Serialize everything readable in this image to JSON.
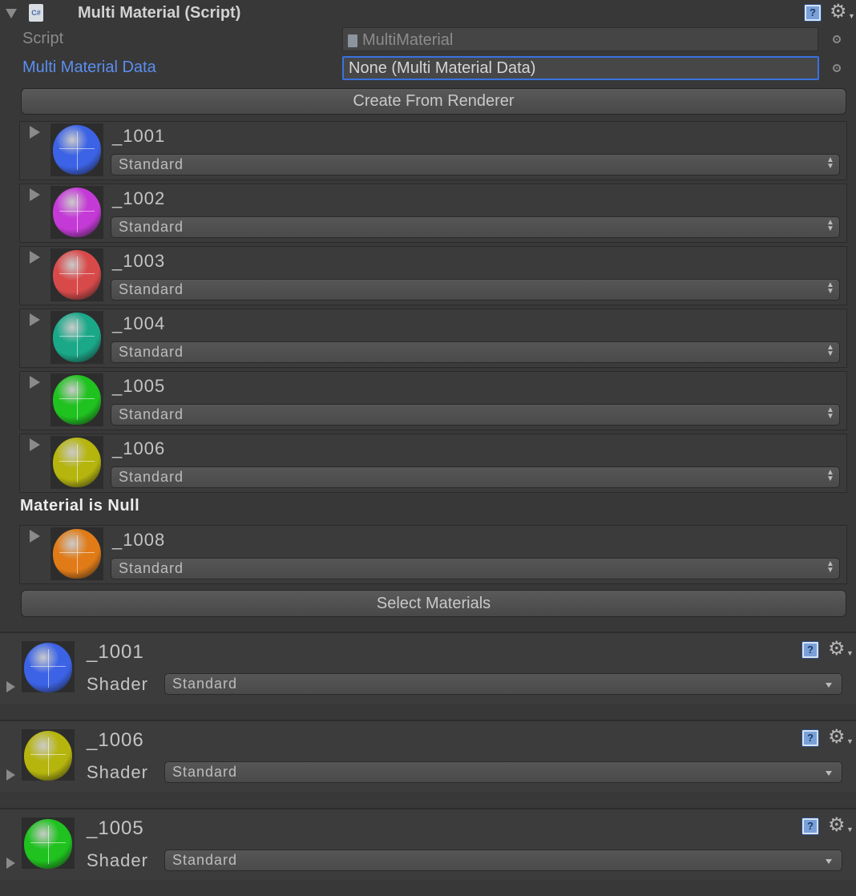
{
  "component": {
    "icon": "csharp-script-icon",
    "icon_text": "C#",
    "title": "Multi Material (Script)",
    "script_label": "Script",
    "script_value": "MultiMaterial",
    "data_label": "Multi Material Data",
    "data_value": "None (Multi Material Data)",
    "create_button": "Create From Renderer",
    "select_button": "Select Materials"
  },
  "colors": {
    "background": "#383838",
    "accent_label": "#5b8ef0",
    "focus_border": "#3a72e0"
  },
  "material_rows": [
    {
      "name": "_1001",
      "shader": "Standard",
      "color": "#3c63e6"
    },
    {
      "name": "_1002",
      "shader": "Standard",
      "color": "#c43ad6"
    },
    {
      "name": "_1003",
      "shader": "Standard",
      "color": "#d84a4a"
    },
    {
      "name": "_1004",
      "shader": "Standard",
      "color": "#1aa889"
    },
    {
      "name": "_1005",
      "shader": "Standard",
      "color": "#1fc21f"
    },
    {
      "name": "_1006",
      "shader": "Standard",
      "color": "#b5b50e"
    }
  ],
  "null_message": "Material is Null",
  "material_rows_after": [
    {
      "name": "_1008",
      "shader": "Standard",
      "color": "#e07b18"
    }
  ],
  "material_inspectors": [
    {
      "name": "_1001",
      "shader_label": "Shader",
      "shader": "Standard",
      "color": "#3c63e6"
    },
    {
      "name": "_1006",
      "shader_label": "Shader",
      "shader": "Standard",
      "color": "#b5b50e"
    },
    {
      "name": "_1005",
      "shader_label": "Shader",
      "shader": "Standard",
      "color": "#1fc21f"
    }
  ]
}
